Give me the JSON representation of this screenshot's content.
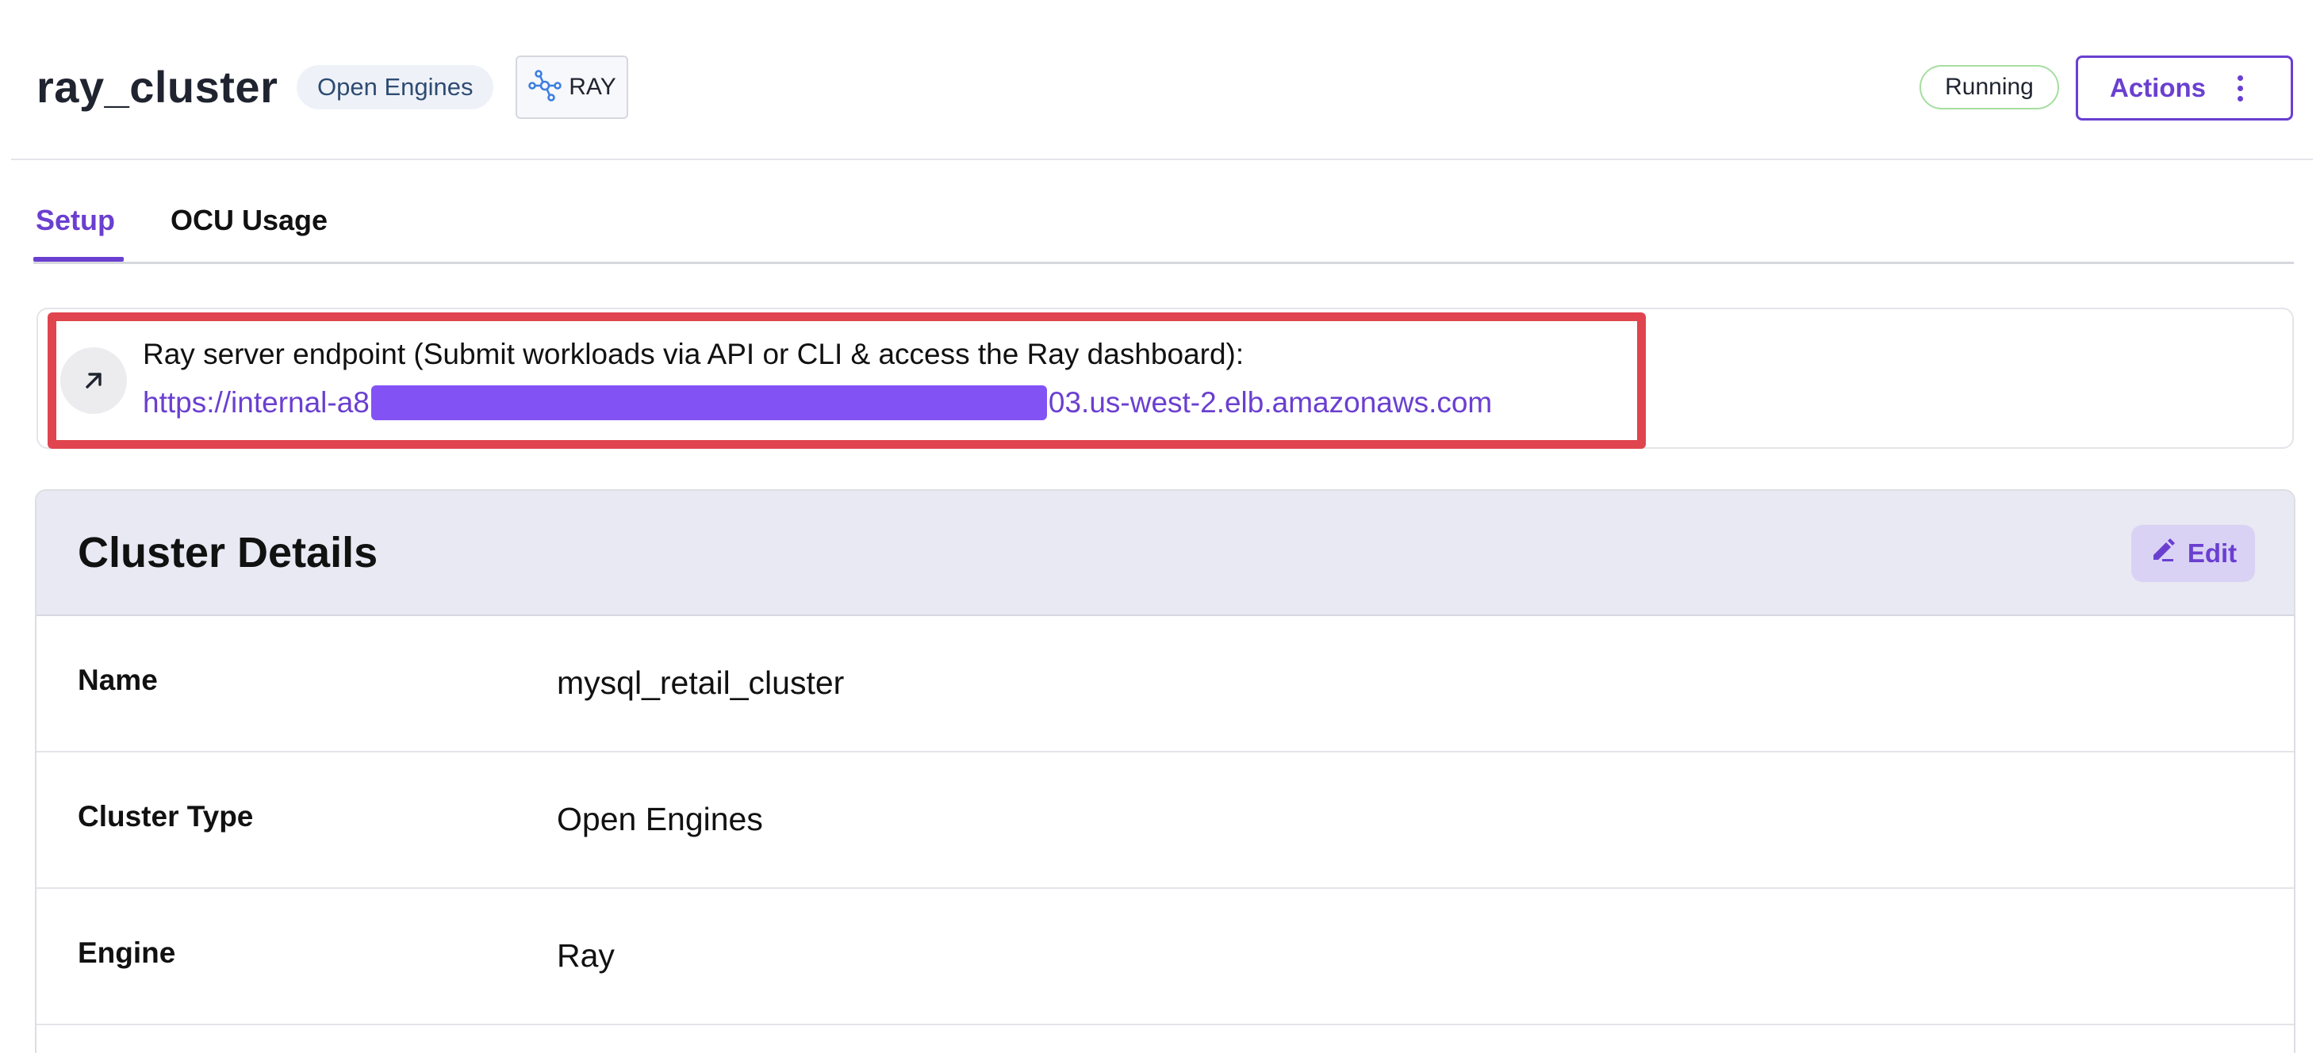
{
  "header": {
    "title": "ray_cluster",
    "type_badge": "Open Engines",
    "engine_badge": "RAY",
    "status": "Running",
    "actions_label": "Actions"
  },
  "tabs": [
    {
      "label": "Setup",
      "active": true
    },
    {
      "label": "OCU Usage",
      "active": false
    }
  ],
  "endpoint": {
    "label": "Ray server endpoint (Submit workloads via API or CLI & access the Ray dashboard):",
    "url_prefix": "https://internal-a8",
    "url_suffix": "03.us-west-2.elb.amazonaws.com"
  },
  "details": {
    "title": "Cluster Details",
    "edit_label": "Edit",
    "rows": [
      {
        "key": "Name",
        "value": "mysql_retail_cluster"
      },
      {
        "key": "Cluster Type",
        "value": "Open Engines"
      },
      {
        "key": "Engine",
        "value": "Ray"
      }
    ]
  },
  "colors": {
    "accent": "#6a3fd0",
    "highlight": "#e0454f",
    "redaction": "#8352f5",
    "status_border": "#a6dea0"
  },
  "icons": {
    "engine": "ray-icon",
    "endpoint": "arrow-up-right-icon",
    "actions": "kebab-vertical-icon",
    "edit": "pencil-icon"
  }
}
